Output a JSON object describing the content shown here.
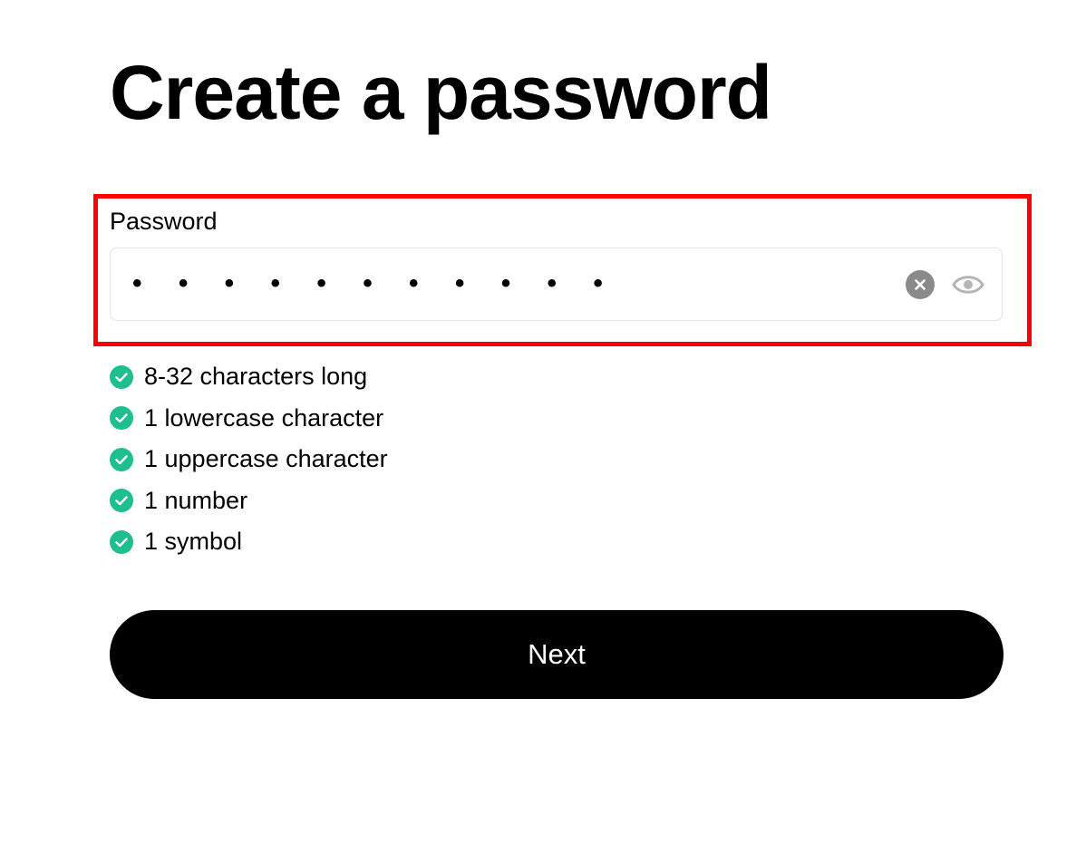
{
  "page": {
    "title": "Create a password"
  },
  "password_field": {
    "label": "Password",
    "value_masked": "• • • • • • • • • • •",
    "clear_icon": "clear-icon",
    "visibility_icon": "eye-icon"
  },
  "requirements": [
    {
      "label": "8-32 characters long",
      "met": true
    },
    {
      "label": "1 lowercase character",
      "met": true
    },
    {
      "label": "1 uppercase character",
      "met": true
    },
    {
      "label": "1 number",
      "met": true
    },
    {
      "label": "1 symbol",
      "met": true
    }
  ],
  "actions": {
    "next_label": "Next"
  },
  "colors": {
    "accent": "#000000",
    "check": "#1dbf8f",
    "highlight": "#ff0000",
    "clear_icon": "#8a8a8a",
    "eye_icon": "#b5b5b5"
  }
}
